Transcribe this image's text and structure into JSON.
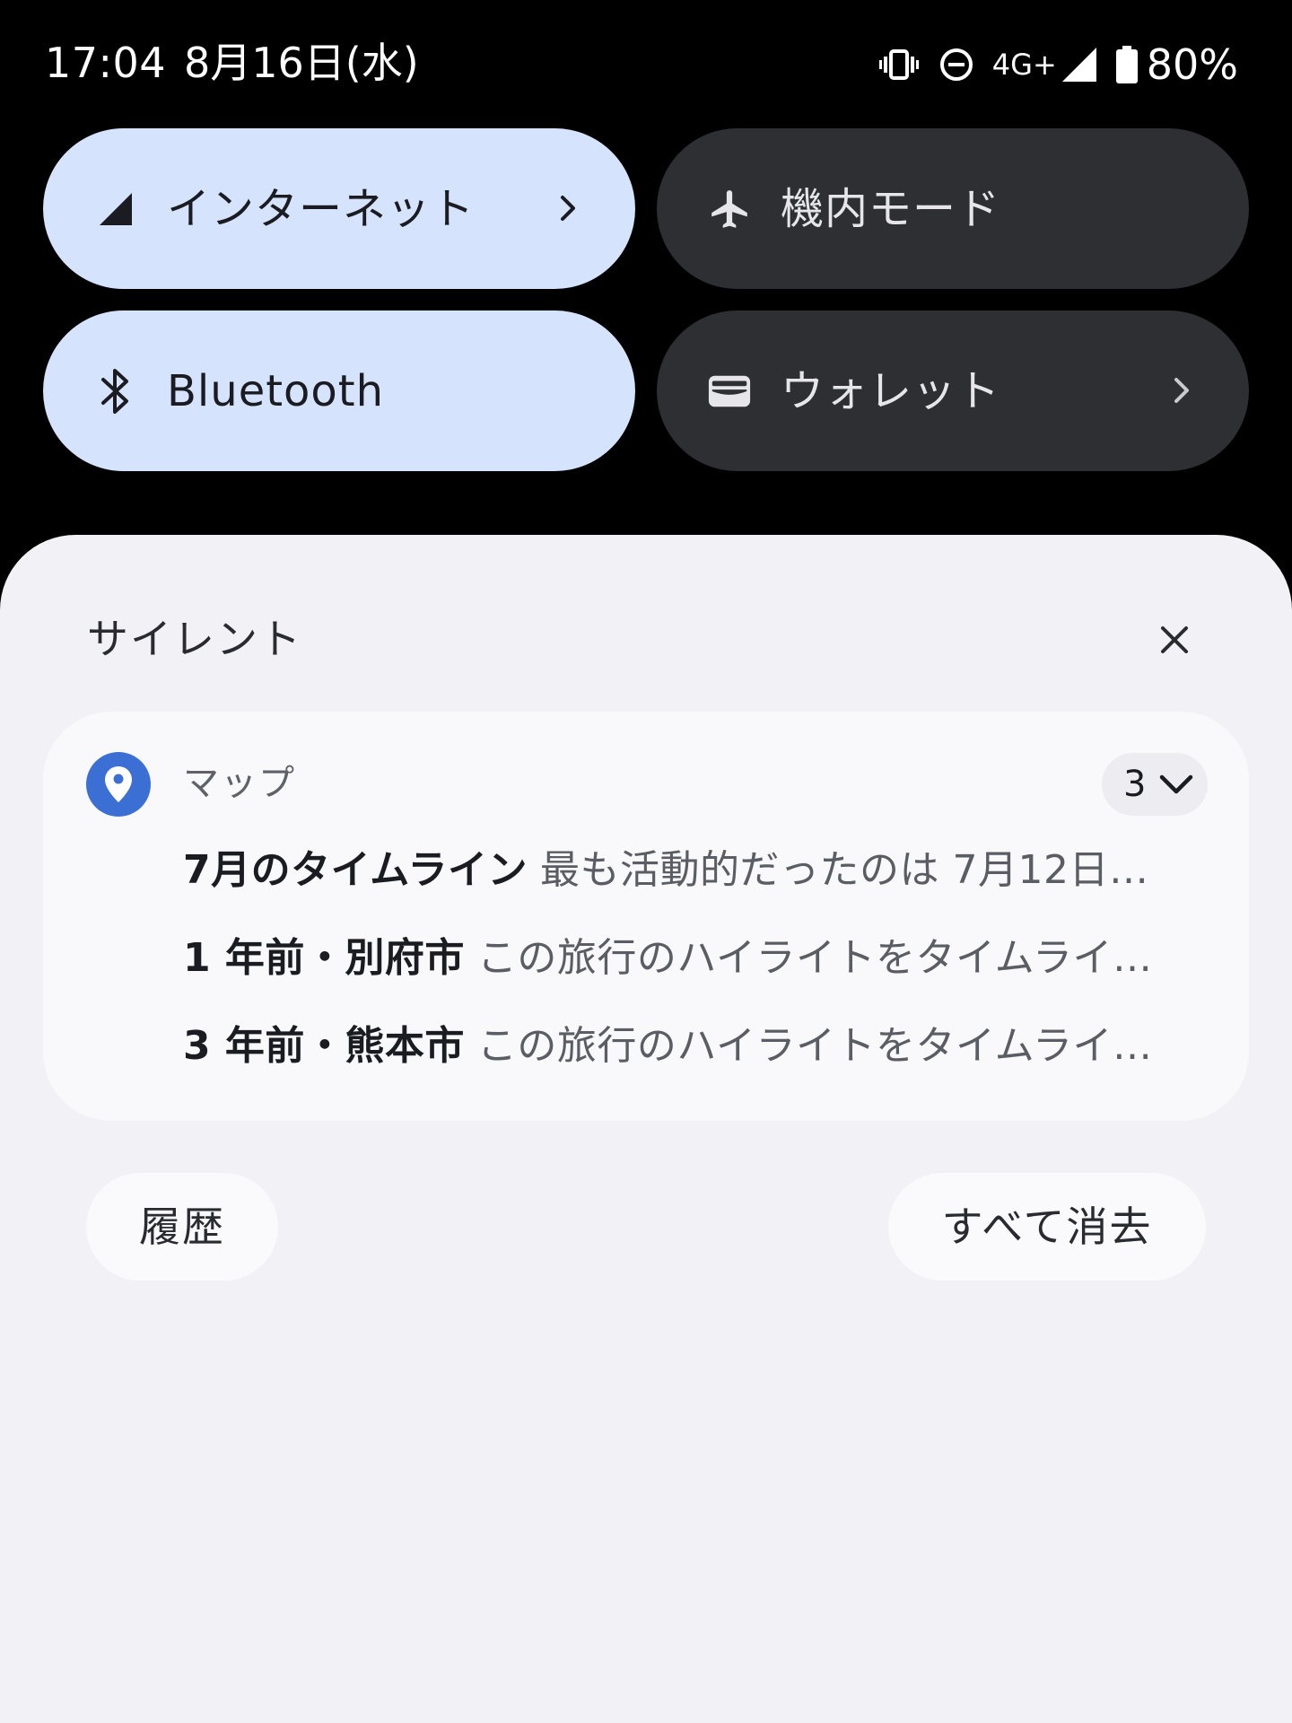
{
  "status_bar": {
    "time": "17:04",
    "date": "8月16日(水)",
    "network": "4G+",
    "battery": "80%"
  },
  "quick_settings": {
    "internet": {
      "label": "インターネット",
      "active": true
    },
    "airplane": {
      "label": "機内モード",
      "active": false
    },
    "bluetooth": {
      "label": "Bluetooth",
      "active": true
    },
    "wallet": {
      "label": "ウォレット",
      "active": false
    }
  },
  "notifications": {
    "section_title": "サイレント",
    "card": {
      "app_name": "マップ",
      "count": "3",
      "items": [
        {
          "title": "7月のタイムライン",
          "text": "最も活動的だったのは 7月12日…"
        },
        {
          "title": "1 年前・別府市",
          "text": "この旅行のハイライトをタイムライ…"
        },
        {
          "title": "3 年前・熊本市",
          "text": "この旅行のハイライトをタイムライ…"
        }
      ]
    },
    "history_label": "履歴",
    "clear_all_label": "すべて消去"
  },
  "colors": {
    "active_tile": "#d6e3fd",
    "inactive_tile": "#2e2f33",
    "shade_bg": "#f1f1f6",
    "maps_icon": "#3b6fd4"
  }
}
